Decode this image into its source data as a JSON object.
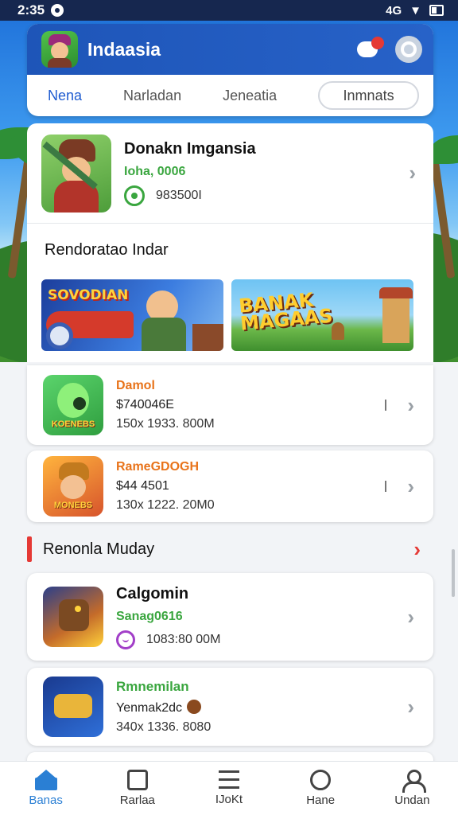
{
  "status_bar": {
    "time": "2:35",
    "network": "4G"
  },
  "app": {
    "title": "Indaasia"
  },
  "tabs": [
    "Nena",
    "Narladan",
    "Jeneatia",
    "Inmnats"
  ],
  "featured": {
    "name": "Donakn Imgansia",
    "subtitle": "Ioha, 0006",
    "metric": "983500I"
  },
  "section_recommend": {
    "title": "Rendoratao Indar"
  },
  "banners": [
    {
      "text": "SOVODIAN"
    },
    {
      "text": "BANAK MAGAAS"
    }
  ],
  "list_items": [
    {
      "title": "Damol",
      "price": "$740046E",
      "stats": "150x 1933. 800M",
      "thumb_text": "KOENEBS"
    },
    {
      "title": "RameGDOGH",
      "price": "$44 4501",
      "stats": "130x 1222. 20M0",
      "thumb_text": "MONEBS"
    }
  ],
  "section_more": {
    "title": "Renonla Muday"
  },
  "more_items": [
    {
      "title": "Calgomin",
      "subtitle": "Sanag0616",
      "stats": "1083:80 00M"
    },
    {
      "title": "Rmnemilan",
      "subtitle": "Yenmak2dc",
      "stats": "340x 1336. 8080"
    }
  ],
  "bottom_nav": [
    "Banas",
    "Rarlaa",
    "IJoKt",
    "Hane",
    "Undan"
  ],
  "colors": {
    "primary": "#2762c8",
    "accent_green": "#3aa63f",
    "accent_orange": "#e8731a",
    "accent_red": "#e53935"
  }
}
